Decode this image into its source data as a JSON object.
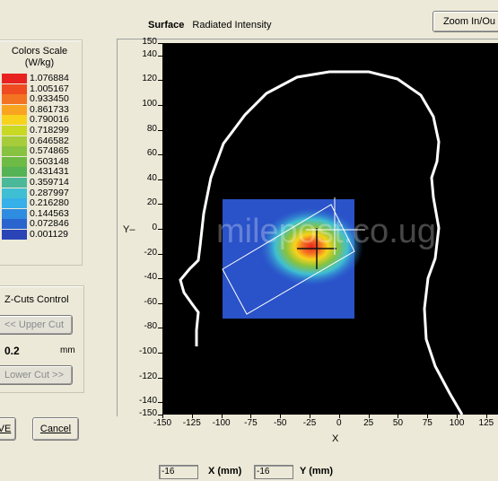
{
  "header": {
    "surface_label": "Surface",
    "surface_value": "Radiated Intensity",
    "zoom_button": "Zoom In/Ou"
  },
  "legend": {
    "title_line1": "Colors Scale",
    "title_line2": "(W/kg)",
    "items": [
      {
        "value": "1.076884",
        "color": "#e8231f"
      },
      {
        "value": "1.005167",
        "color": "#ef4a20"
      },
      {
        "value": "0.933450",
        "color": "#f47322"
      },
      {
        "value": "0.861733",
        "color": "#f9a421"
      },
      {
        "value": "0.790016",
        "color": "#f7d31b"
      },
      {
        "value": "0.718299",
        "color": "#c8d823"
      },
      {
        "value": "0.646582",
        "color": "#a6cc3a"
      },
      {
        "value": "0.574865",
        "color": "#87c240"
      },
      {
        "value": "0.503148",
        "color": "#6dba44"
      },
      {
        "value": "0.431431",
        "color": "#55b355"
      },
      {
        "value": "0.359714",
        "color": "#4cb89a"
      },
      {
        "value": "0.287997",
        "color": "#3ebfd4"
      },
      {
        "value": "0.216280",
        "color": "#35b0e8"
      },
      {
        "value": "0.144563",
        "color": "#2e8de0"
      },
      {
        "value": "0.072846",
        "color": "#2a64cf"
      },
      {
        "value": "0.001129",
        "color": "#2a44b8"
      }
    ]
  },
  "zcuts": {
    "title": "Z-Cuts Control",
    "upper_button": "<< Upper Cut",
    "value": "0.2",
    "unit": "mm",
    "lower_button": "Lower Cut >>"
  },
  "buttons": {
    "save_partial": "VE",
    "cancel": "Cancel"
  },
  "plot": {
    "y_axis_letter": "Y",
    "x_axis_letter": "X",
    "y_ticks": [
      "150",
      "140",
      "120",
      "100",
      "80",
      "60",
      "40",
      "20",
      "0",
      "-20",
      "-40",
      "-60",
      "-80",
      "-100",
      "-120",
      "-140",
      "-150"
    ],
    "x_ticks": [
      "-150",
      "-125",
      "-100",
      "-75",
      "-50",
      "-25",
      "0",
      "25",
      "50",
      "75",
      "100",
      "125"
    ],
    "watermark": "milepost.co.ug"
  },
  "coords": {
    "x_value": "-16",
    "x_label": "X (mm)",
    "y_value": "-16",
    "y_label": "Y (mm)"
  }
}
